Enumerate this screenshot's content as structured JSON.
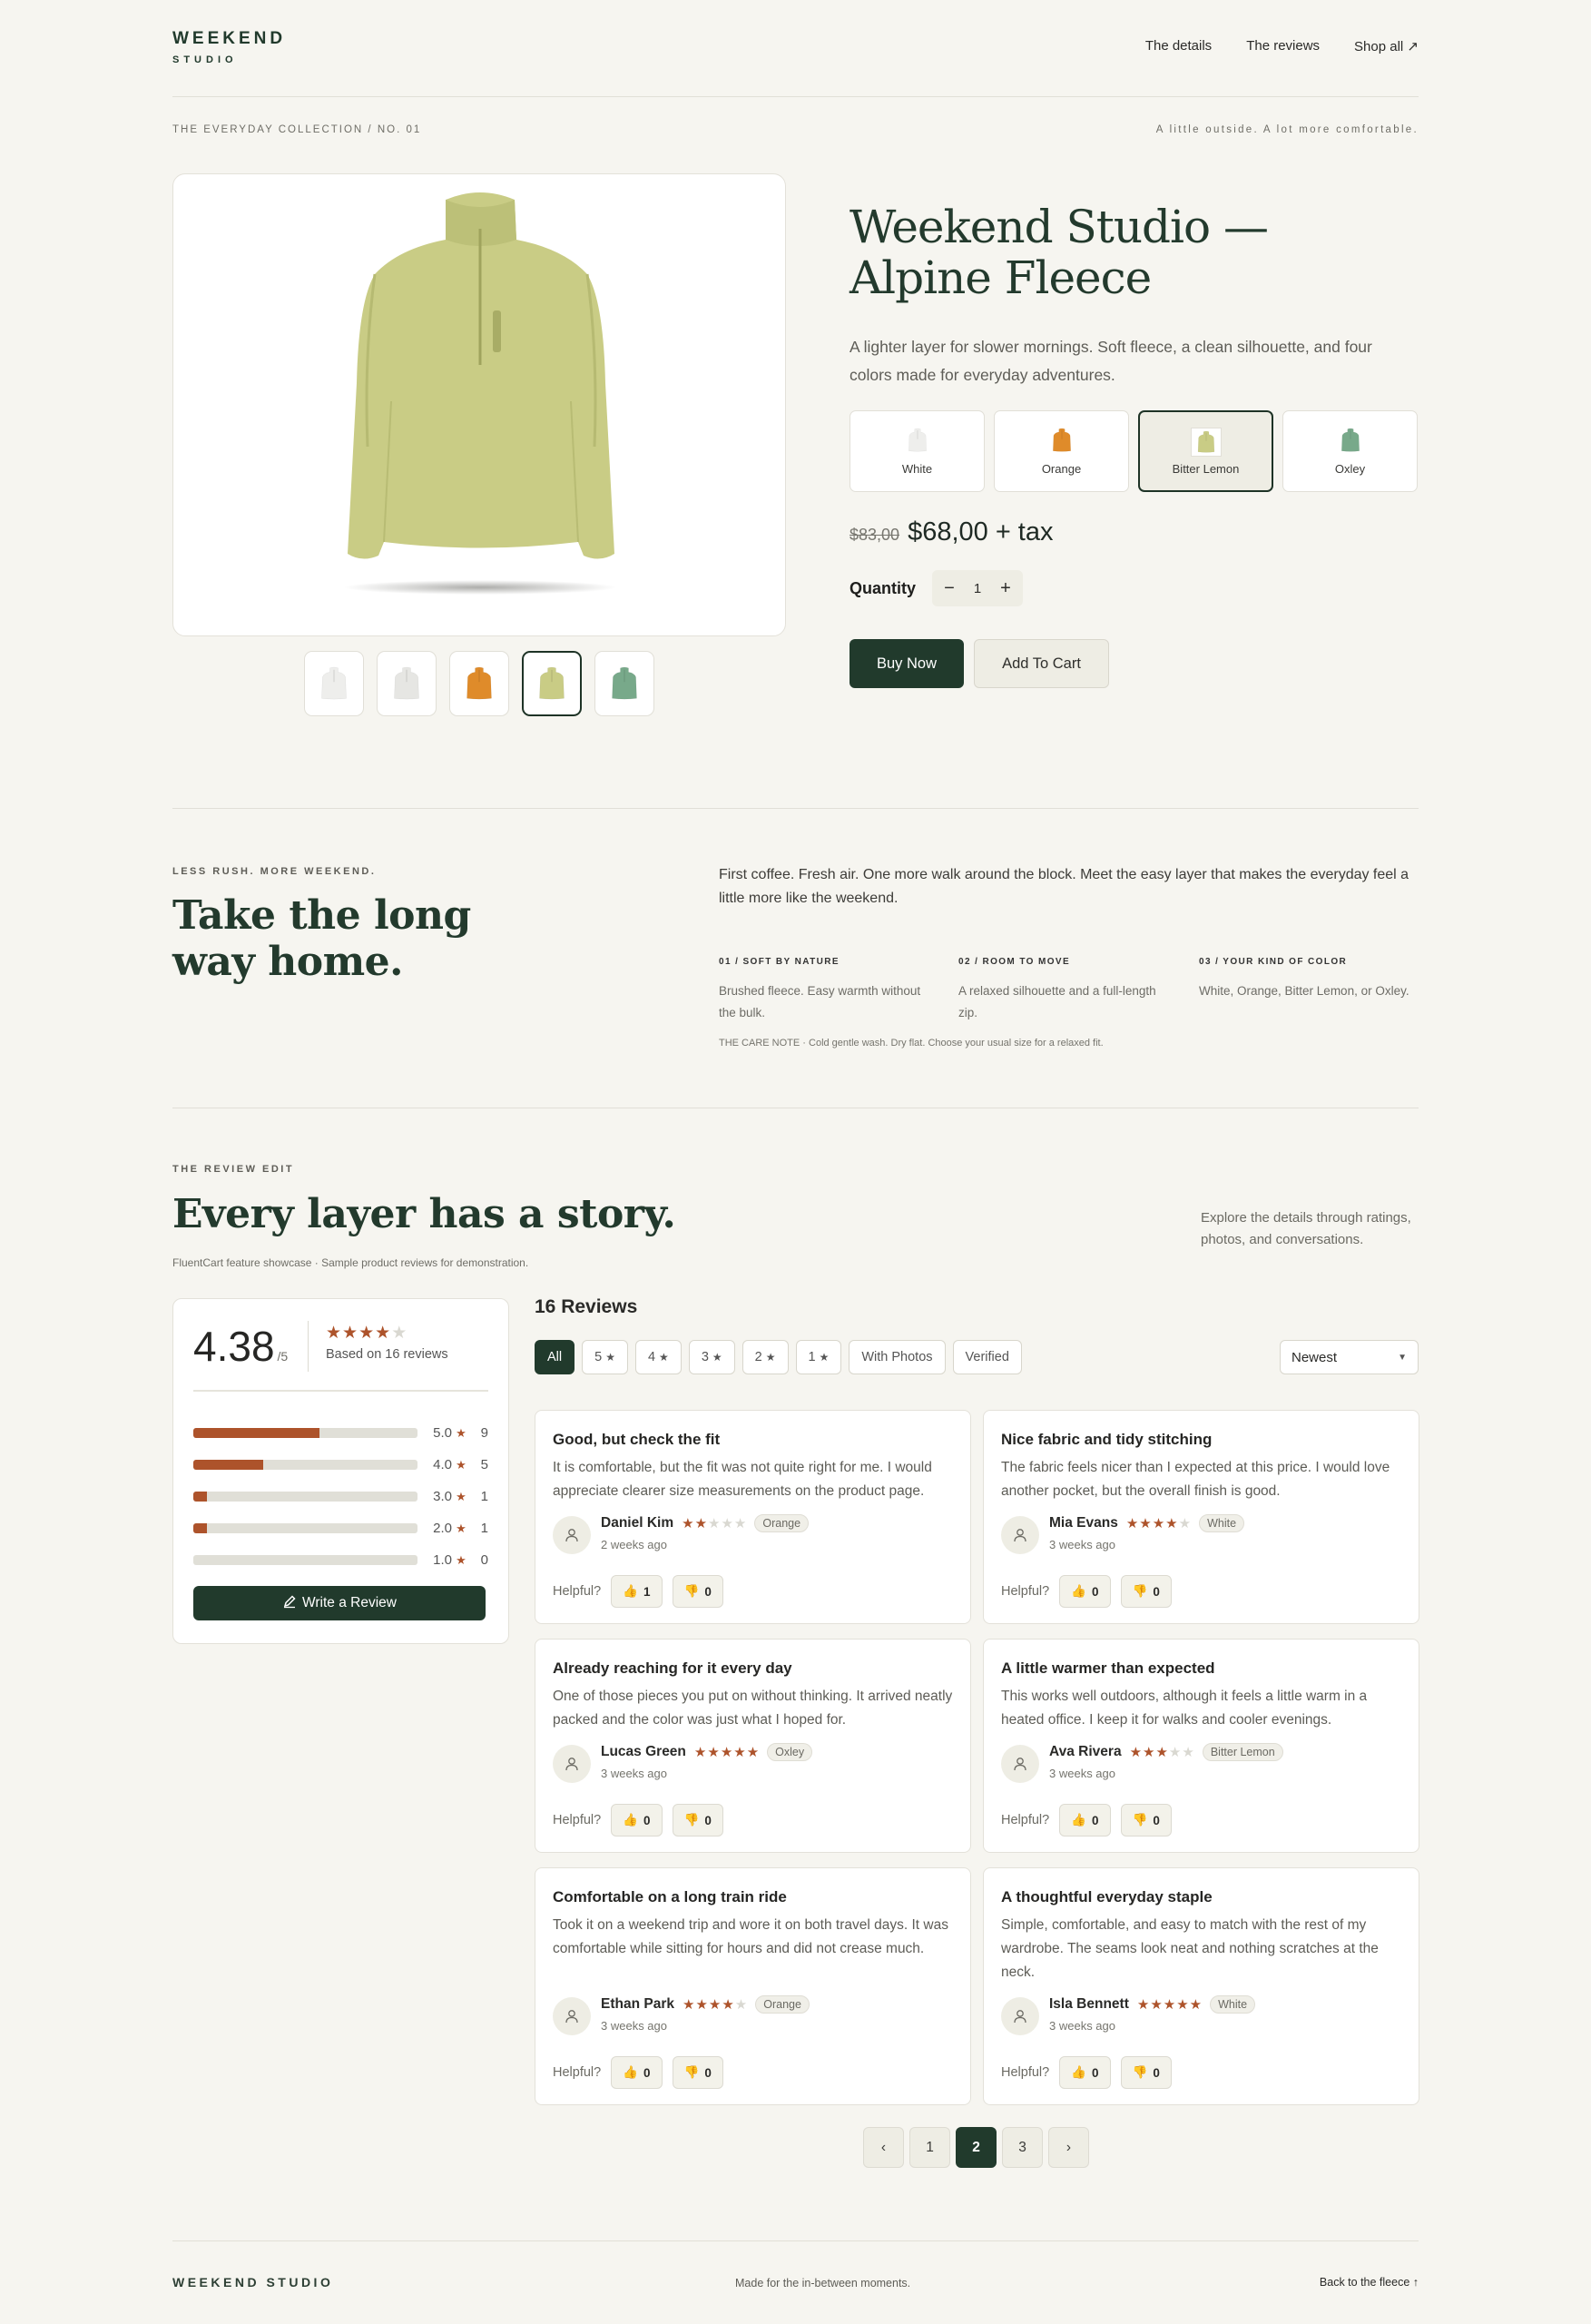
{
  "header": {
    "brand_line1": "WEEKEND",
    "brand_line2": "STUDIO",
    "nav": [
      "The details",
      "The reviews",
      "Shop all ↗"
    ]
  },
  "eyebrow": {
    "left": "THE EVERYDAY COLLECTION / NO. 01",
    "right": "A little outside. A lot more comfortable."
  },
  "product": {
    "title": "Weekend Studio — Alpine Fleece",
    "description": "A lighter layer for slower mornings. Soft fleece, a clean silhouette, and four colors made for everyday adventures.",
    "image_color": "#c9cc85",
    "thumbnails": [
      {
        "name": "white-front",
        "color": "#eeeeec"
      },
      {
        "name": "white-back",
        "color": "#e6e6e3"
      },
      {
        "name": "orange",
        "color": "#df8b2a"
      },
      {
        "name": "bitter-lemon",
        "color": "#c9cc85",
        "active": true
      },
      {
        "name": "oxley",
        "color": "#78a98a"
      }
    ],
    "colors": [
      {
        "label": "White",
        "color": "#eeeeec"
      },
      {
        "label": "Orange",
        "color": "#df8b2a"
      },
      {
        "label": "Bitter Lemon",
        "color": "#c9cc85",
        "selected": true
      },
      {
        "label": "Oxley",
        "color": "#78a98a"
      }
    ],
    "old_price": "$83,00",
    "price": "$68,00 + tax",
    "quantity_label": "Quantity",
    "quantity": "1",
    "buy_label": "Buy Now",
    "cart_label": "Add To Cart"
  },
  "story": {
    "eyebrow": "LESS RUSH. MORE WEEKEND.",
    "title": "Take the long way home.",
    "intro": "First coffee. Fresh air. One more walk around the block. Meet the easy layer that makes the everyday feel a little more like the weekend.",
    "features": [
      {
        "heading": "01 / SOFT BY NATURE",
        "body": "Brushed fleece. Easy warmth without the bulk."
      },
      {
        "heading": "02 / ROOM TO MOVE",
        "body": "A relaxed silhouette and a full-length zip."
      },
      {
        "heading": "03 / YOUR KIND OF COLOR",
        "body": "White, Orange, Bitter Lemon, or Oxley."
      }
    ],
    "care_note": "THE CARE NOTE · Cold gentle wash. Dry flat. Choose your usual size for a relaxed fit."
  },
  "reviews": {
    "eyebrow": "THE REVIEW EDIT",
    "title": "Every layer has a story.",
    "note": "FluentCart feature showcase · Sample product reviews for demonstration.",
    "side_text": "Explore the details through ratings, photos, and conversations.",
    "average": "4.38",
    "out_of": "/5",
    "average_stars": 4,
    "based_on": "Based on 16 reviews",
    "distribution": [
      {
        "label": "5.0",
        "count": "9",
        "fraction": 0.5625
      },
      {
        "label": "4.0",
        "count": "5",
        "fraction": 0.3125
      },
      {
        "label": "3.0",
        "count": "1",
        "fraction": 0.0625
      },
      {
        "label": "2.0",
        "count": "1",
        "fraction": 0.0625
      },
      {
        "label": "1.0",
        "count": "0",
        "fraction": 0
      }
    ],
    "write_label": "Write a Review",
    "count_label": "16 Reviews",
    "filters": [
      "All",
      "5",
      "4",
      "3",
      "2",
      "1",
      "With Photos",
      "Verified"
    ],
    "sort": "Newest",
    "helpful_label": "Helpful?",
    "items": [
      {
        "title": "Good, but check the fit",
        "body": "It is comfortable, but the fit was not quite right for me. I would appreciate clearer size measurements on the product page.",
        "author": "Daniel Kim",
        "stars": 2,
        "tag": "Orange",
        "when": "2 weeks ago",
        "up": "1",
        "down": "0"
      },
      {
        "title": "Nice fabric and tidy stitching",
        "body": "The fabric feels nicer than I expected at this price. I would love another pocket, but the overall finish is good.",
        "author": "Mia Evans",
        "stars": 4,
        "tag": "White",
        "when": "3 weeks ago",
        "up": "0",
        "down": "0"
      },
      {
        "title": "Already reaching for it every day",
        "body": "One of those pieces you put on without thinking. It arrived neatly packed and the color was just what I hoped for.",
        "author": "Lucas Green",
        "stars": 5,
        "tag": "Oxley",
        "when": "3 weeks ago",
        "up": "0",
        "down": "0"
      },
      {
        "title": "A little warmer than expected",
        "body": "This works well outdoors, although it feels a little warm in a heated office. I keep it for walks and cooler evenings.",
        "author": "Ava Rivera",
        "stars": 3,
        "tag": "Bitter Lemon",
        "when": "3 weeks ago",
        "up": "0",
        "down": "0"
      },
      {
        "title": "Comfortable on a long train ride",
        "body": "Took it on a weekend trip and wore it on both travel days. It was comfortable while sitting for hours and did not crease much.",
        "author": "Ethan Park",
        "stars": 4,
        "tag": "Orange",
        "when": "3 weeks ago",
        "up": "0",
        "down": "0"
      },
      {
        "title": "A thoughtful everyday staple",
        "body": "Simple, comfortable, and easy to match with the rest of my wardrobe. The seams look neat and nothing scratches at the neck.",
        "author": "Isla Bennett",
        "stars": 5,
        "tag": "White",
        "when": "3 weeks ago",
        "up": "0",
        "down": "0"
      }
    ],
    "pages": [
      "‹",
      "1",
      "2",
      "3",
      "›"
    ],
    "current_page": "2"
  },
  "footer": {
    "brand": "WEEKEND STUDIO",
    "tagline": "Made for the in-between moments.",
    "back": "Back to the fleece ↑"
  }
}
